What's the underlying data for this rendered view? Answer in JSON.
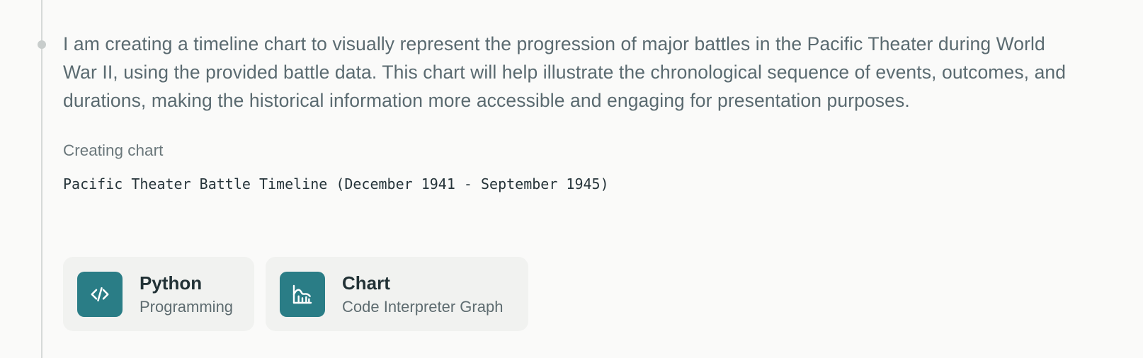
{
  "message": {
    "description": "I am creating a timeline chart to visually represent the progression of major battles in the Pacific Theater during World War II, using the provided battle data. This chart will help illustrate the chronological sequence of events, outcomes, and durations, making the historical information more accessible and engaging for presentation purposes.",
    "step_label": "Creating chart",
    "chart_title": "Pacific Theater Battle Timeline (December 1941 - September 1945)"
  },
  "tools": [
    {
      "name": "Python",
      "subtitle": "Programming",
      "icon": "code-icon"
    },
    {
      "name": "Chart",
      "subtitle": "Code Interpreter Graph",
      "icon": "chart-icon"
    }
  ],
  "colors": {
    "accent": "#2a7d86",
    "background": "#fafaf9",
    "card": "#f1f2f0",
    "text_body": "#5a6a70",
    "text_title": "#223236"
  }
}
